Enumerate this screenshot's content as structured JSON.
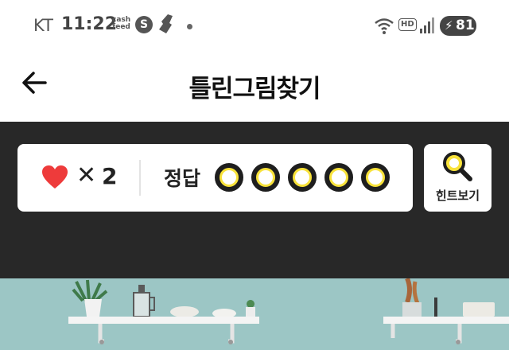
{
  "status_bar": {
    "carrier": "KT",
    "time": "11:22",
    "app_badge_top": "cash",
    "app_badge_bottom": "feed",
    "battery_level": "81"
  },
  "header": {
    "title": "틀린그림찾기"
  },
  "game": {
    "lives_symbol": "✕",
    "lives_count": "2",
    "answer_label": "정답",
    "answers_total": 5,
    "answers_found": 0,
    "hint_label": "힌트보기"
  },
  "colors": {
    "accent_yellow": "#f8e23a",
    "heart_red": "#ee3b3b",
    "dark_band": "#282828",
    "picture_wall": "#9cc6c5"
  }
}
